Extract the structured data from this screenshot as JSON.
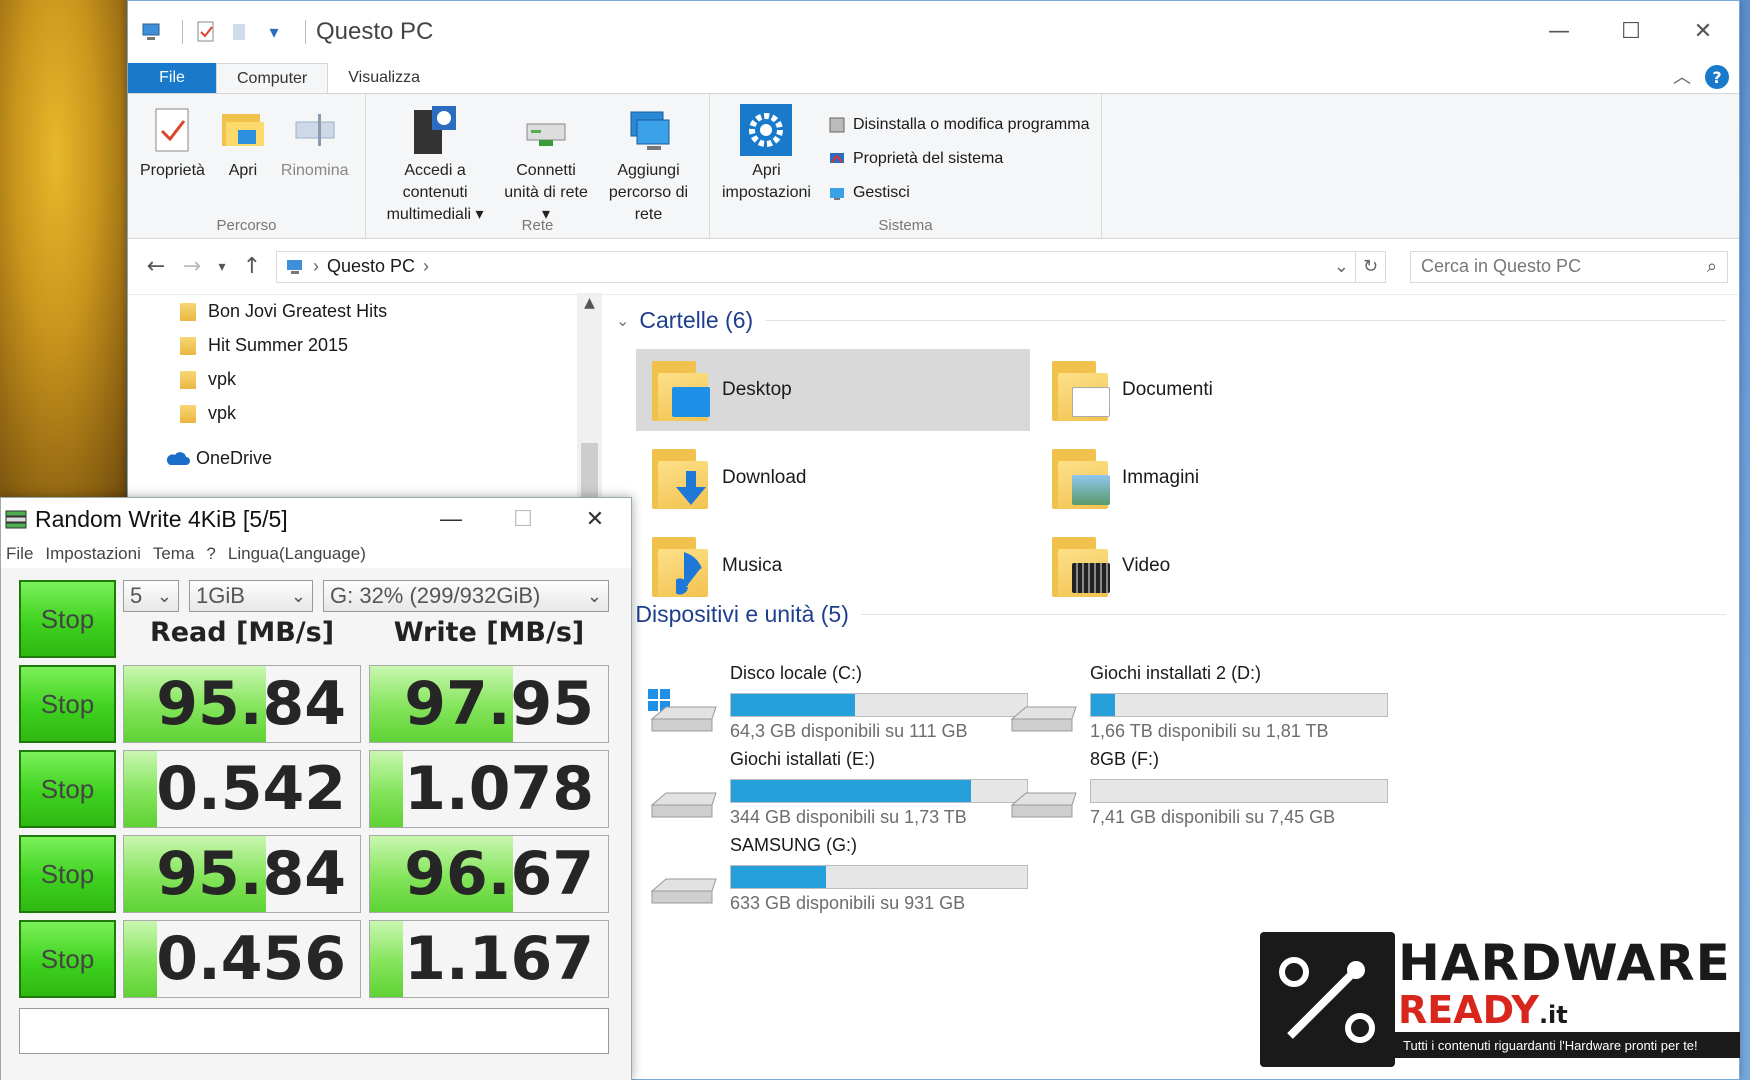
{
  "explorer": {
    "title": "Questo PC",
    "tabs": {
      "file": "File",
      "computer": "Computer",
      "view": "Visualizza"
    },
    "ribbon": {
      "percorso": {
        "label": "Percorso",
        "proprieta": "Proprietà",
        "apri": "Apri",
        "rinomina": "Rinomina"
      },
      "rete": {
        "label": "Rete",
        "media_l1": "Accedi a contenuti",
        "media_l2": "multimediali",
        "map_l1": "Connetti",
        "map_l2": "unità di rete",
        "addnet_l1": "Aggiungi",
        "addnet_l2": "percorso di rete"
      },
      "sistema": {
        "label": "Sistema",
        "settings_l1": "Apri",
        "settings_l2": "impostazioni",
        "uninstall": "Disinstalla o modifica programma",
        "sysprops": "Proprietà del sistema",
        "manage": "Gestisci"
      }
    },
    "address": {
      "crumb": "Questo PC"
    },
    "search": {
      "placeholder": "Cerca in Questo PC"
    },
    "nav": {
      "items": [
        "Bon Jovi Greatest Hits",
        "Hit Summer 2015",
        "vpk",
        "vpk"
      ],
      "onedrive": "OneDrive"
    },
    "folders": {
      "header": "Cartelle (6)",
      "items": [
        "Desktop",
        "Documenti",
        "Download",
        "Immagini",
        "Musica",
        "Video"
      ]
    },
    "devices": {
      "header": "Dispositivi e unità (5)",
      "items": [
        {
          "name": "Disco locale (C:)",
          "free": "64,3 GB disponibili su 111 GB",
          "used": 0.42
        },
        {
          "name": "Giochi installati 2 (D:)",
          "free": "1,66 TB disponibili su 1,81 TB",
          "used": 0.08
        },
        {
          "name": "Giochi istallati (E:)",
          "free": "344 GB disponibili su 1,73 TB",
          "used": 0.81
        },
        {
          "name": "8GB (F:)",
          "free": "7,41 GB disponibili su 7,45 GB",
          "used": 0.0
        },
        {
          "name": "SAMSUNG (G:)",
          "free": "633 GB disponibili su 931 GB",
          "used": 0.32
        }
      ]
    }
  },
  "cdm": {
    "title": "Random Write 4KiB [5/5]",
    "menu": [
      "File",
      "Impostazioni",
      "Tema",
      "?",
      "Lingua(Language)"
    ],
    "count": "5",
    "size": "1GiB",
    "drive": "G: 32% (299/932GiB)",
    "read_header": "Read [MB/s]",
    "write_header": "Write [MB/s]",
    "stop": "Stop",
    "rows": [
      {
        "read": "95.84",
        "write": "97.95",
        "read_level": 0.6,
        "write_level": 0.6
      },
      {
        "read": "0.542",
        "write": "1.078",
        "read_level": 0.14,
        "write_level": 0.14
      },
      {
        "read": "95.84",
        "write": "96.67",
        "read_level": 0.6,
        "write_level": 0.6
      },
      {
        "read": "0.456",
        "write": "1.167",
        "read_level": 0.14,
        "write_level": 0.14
      }
    ]
  },
  "logo": {
    "hw": "HARDWARE",
    "ready": "READY",
    "tld": ".it",
    "tagline": "Tutti i contenuti riguardanti l'Hardware pronti per te!"
  }
}
